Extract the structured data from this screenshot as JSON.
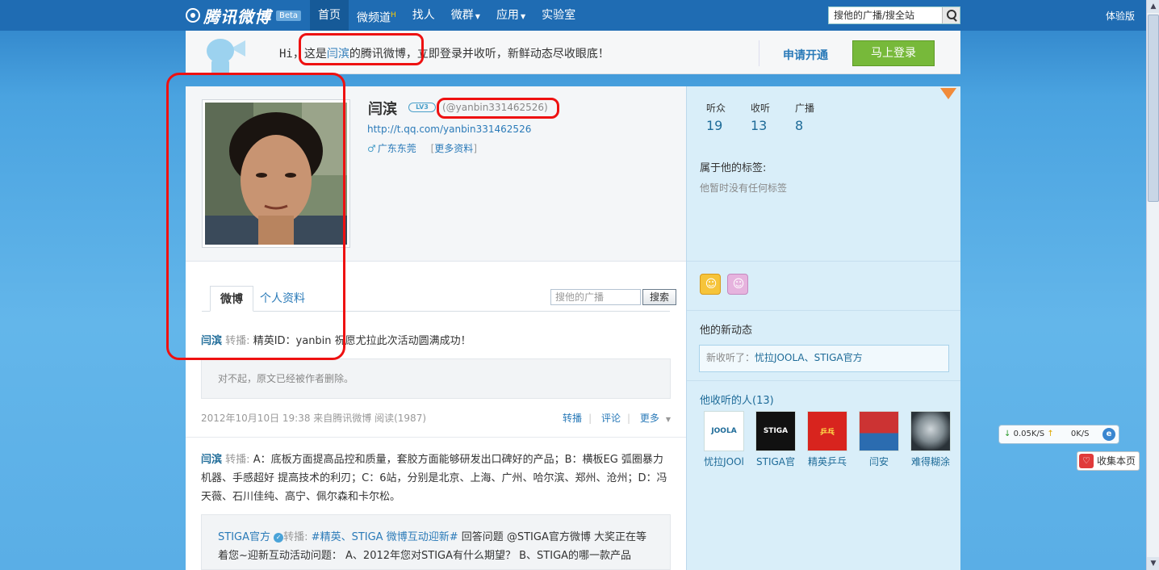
{
  "header": {
    "logo_text": "腾讯微博",
    "beta": "Beta",
    "nav": [
      {
        "label": "首页",
        "active": true
      },
      {
        "label": "微频道",
        "badge": "H"
      },
      {
        "label": "找人"
      },
      {
        "label": "微群",
        "dropdown": true
      },
      {
        "label": "应用",
        "dropdown": true
      },
      {
        "label": "实验室"
      }
    ],
    "search_placeholder": "搜他的广播/搜全站",
    "experience": "体验版"
  },
  "banner": {
    "greeting_prefix": "Hi，",
    "greeting_this_is": "这是",
    "greeting_name": "闫滨",
    "greeting_middle": "的腾讯微博，",
    "greeting_suffix": "立即登录并收听，新鲜动态尽收眼底！",
    "apply_label": "申请开通",
    "login_label": "马上登录"
  },
  "profile": {
    "name": "闫滨",
    "level": "LV3",
    "handle": "(@yanbin331462526)",
    "url": "http://t.qq.com/yanbin331462526",
    "gender_icon": "♂",
    "location": "广东东莞",
    "more_label": "更多资料"
  },
  "tabs": {
    "weibo": "微博",
    "personal": "个人资料",
    "search_placeholder": "搜他的广播",
    "search_button": "搜索"
  },
  "feed": {
    "post1": {
      "author": "闫滨",
      "rt_label": "转播:",
      "text": "精英ID：yanbin 祝愿尤拉此次活动圆满成功！",
      "quote": "对不起，原文已经被作者删除。",
      "time": "2012年10月10日  19:38 来自腾讯微博  阅读(1987)",
      "actions": [
        "转播",
        "评论",
        "更多"
      ]
    },
    "post2": {
      "author": "闫滨",
      "rt_label": "转播:",
      "text": "A：底板方面提高品控和质量，套胶方面能够研发出口碑好的产品；B：横板EG 弧圈暴力机器、手感超好 提高技术的利刃；C：6站，分别是北京、上海、广州、哈尔滨、郑州、沧州；D：冯天薇、石川佳纯、高宁、佩尔森和卡尔松。",
      "quote_author": "STIGA官方",
      "quote_topic": "#精英、STIGA 微博互动迎新#",
      "quote_text": " 回答问题 @STIGA官方微博 大奖正在等着您~迎新互动活动问题：  A、2012年您对STIGA有什么期望？  B、STIGA的哪一款产品"
    }
  },
  "sidebar": {
    "stats": [
      {
        "label": "听众",
        "value": "19"
      },
      {
        "label": "收听",
        "value": "13"
      },
      {
        "label": "广播",
        "value": "8"
      }
    ],
    "tags_title": "属于他的标签:",
    "tags_empty": "他暂时没有任何标签",
    "news_title": "他的新动态",
    "news_prefix": "新收听了：",
    "news_links": "忧拉JOOLA、STIGA官方",
    "follow_title": "他收听的人(13)",
    "follows": [
      {
        "name": "忧拉JOOl",
        "pic_text": "JOOLA"
      },
      {
        "name": "STIGA官",
        "pic_text": "STIGA"
      },
      {
        "name": "精英乒乓",
        "pic_text": "乒乓"
      },
      {
        "name": "闫安",
        "pic_text": ""
      },
      {
        "name": "难得糊涂",
        "pic_text": ""
      }
    ]
  },
  "widgets": {
    "speed_down": "0.05K/S",
    "speed_up": "0K/S",
    "collect": "收集本页"
  }
}
